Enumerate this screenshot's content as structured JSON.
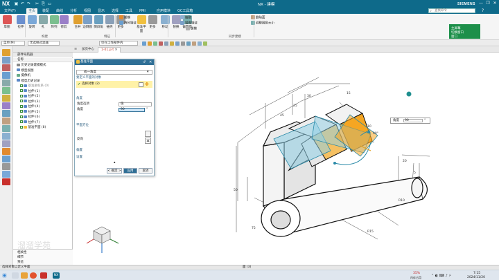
{
  "app": {
    "logo": "NX",
    "document_title": "NX - 建模",
    "brand": "SIEMENS",
    "window_controls": [
      "—",
      "❐",
      "✕"
    ]
  },
  "menu": {
    "items": [
      "文件(F)",
      "主页",
      "装配",
      "曲线",
      "分析",
      "视图",
      "显示",
      "选择",
      "工具",
      "PMI",
      "应用模块",
      "GC工具箱"
    ],
    "active_index": 1,
    "search_placeholder": "查找命令"
  },
  "ribbon": {
    "large_buttons": [
      "草图",
      "拉伸",
      "旋转",
      "孔",
      "阵列",
      "修剪",
      "合并",
      "边倒圆",
      "倒斜角",
      "抽壳",
      "更多",
      "基准平面",
      "更多",
      "移动",
      "替换",
      "偏置面"
    ],
    "small_buttons": [
      "拔模",
      "阵列特征",
      "抽取",
      "镜像特征",
      "拔模",
      "删除面",
      "调整圆角大小"
    ],
    "groups": [
      "构建",
      "特征",
      "同步建模"
    ],
    "green_panel": [
      "主屏幕",
      "切换窗口",
      "窗口"
    ]
  },
  "selection_bar": {
    "menu_label": "菜单(M)",
    "filter": "无选择过滤器",
    "scope": "仅在工作部件内"
  },
  "tabs": {
    "items": [
      "加页中心",
      "1-01.prt"
    ]
  },
  "navigator": {
    "title": "部件导航器",
    "column": "名称",
    "rows": [
      {
        "label": "历史记录建模模式",
        "indent": 1,
        "icon": "history"
      },
      {
        "label": "模型视图",
        "indent": 1,
        "icon": "folder"
      },
      {
        "label": "摄像机",
        "indent": 1,
        "icon": "camera"
      },
      {
        "label": "模型历史记录",
        "indent": 1,
        "icon": "folder"
      },
      {
        "label": "基准坐标系 (0)",
        "indent": 2,
        "icon": "csys",
        "dim": true
      },
      {
        "label": "拉伸 (1)",
        "indent": 2,
        "icon": "feature"
      },
      {
        "label": "拉伸 (2)",
        "indent": 2,
        "icon": "feature"
      },
      {
        "label": "拉伸 (3)",
        "indent": 2,
        "icon": "feature"
      },
      {
        "label": "拉伸 (4)",
        "indent": 2,
        "icon": "feature"
      },
      {
        "label": "拉伸 (5)",
        "indent": 2,
        "icon": "feature"
      },
      {
        "label": "拉伸 (6)",
        "indent": 2,
        "icon": "feature"
      },
      {
        "label": "拉伸 (7)",
        "indent": 2,
        "icon": "feature"
      },
      {
        "label": "基准平面 (8)",
        "indent": 2,
        "icon": "plane"
      }
    ],
    "footer_items": [
      "相关性",
      "细节",
      "预览"
    ]
  },
  "dialog": {
    "title": "基准平面",
    "type_value": "成一角度",
    "section_1": "要定义平面的对象",
    "select_object": "选择对象 (2)",
    "section_2": "角度",
    "angle_option_label": "角度选项",
    "angle_option_value": "值",
    "angle_label": "角度",
    "angle_value": "90",
    "angle_unit": "°",
    "section_3": "平面方位",
    "reverse_label": "反向",
    "section_4": "偏置",
    "section_5": "设置",
    "ok": "< 确定 >",
    "apply": "应用",
    "cancel": "取消"
  },
  "viewport": {
    "float_label": "角度",
    "float_value": "90",
    "float_unit": "°",
    "dims": [
      "30",
      "45",
      "25",
      "15",
      "10",
      "50",
      "75",
      "R15",
      "R10",
      "20",
      "5",
      "90°"
    ],
    "watermark": "溜溜学苑"
  },
  "status": {
    "left": "选择对象以定义平面",
    "center": "面 (3)"
  },
  "taskbar": {
    "cpu": "35%",
    "cpu_label": "内存占用",
    "time": "7:15",
    "date": "2024/11/20"
  },
  "colors": {
    "titlebar": "#0e6a8a",
    "accent": "#2f6f96",
    "highlight": "#f5a623",
    "plane": "#8fd0e6",
    "select_yellow": "#fff2a8"
  }
}
